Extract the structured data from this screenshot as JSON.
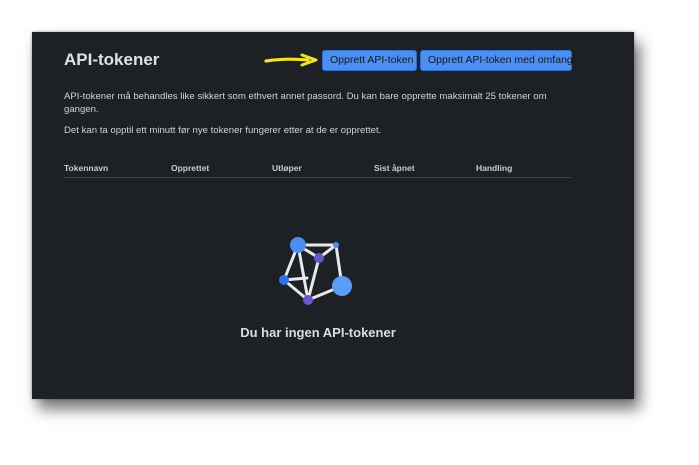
{
  "page": {
    "title": "API-tokener",
    "description_1": "API-tokener må behandles like sikkert som ethvert annet passord. Du kan bare opprette maksimalt 25 tokener om gangen.",
    "description_2": "Det kan ta opptil ett minutt før nye tokener fungerer etter at de er opprettet."
  },
  "actions": {
    "create_token": "Opprett API-token",
    "create_scoped_token": "Opprett API-token med omfang"
  },
  "table": {
    "columns": [
      "Tokennavn",
      "Opprettet",
      "Utløper",
      "Sist åpnet",
      "Handling"
    ]
  },
  "empty_state": {
    "message": "Du har ingen API-tokener",
    "illustration": "network-graph-icon"
  },
  "colors": {
    "background": "#1d2025",
    "button": "#4d8fee",
    "arrow": "#f2e12b",
    "node_blue": "#4d8fee",
    "node_purple": "#6b55c9"
  }
}
